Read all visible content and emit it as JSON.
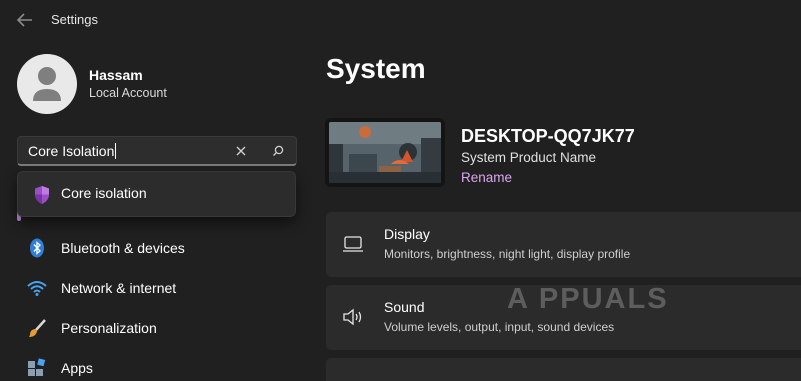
{
  "window": {
    "title": "Settings",
    "back_icon": "back-arrow-icon"
  },
  "user": {
    "name": "Hassam",
    "account_type": "Local Account",
    "avatar_icon": "user-avatar-icon"
  },
  "search": {
    "value": "Core Isolation",
    "clear_icon": "close-icon",
    "search_icon": "search-icon",
    "suggestions": [
      {
        "label": "Core isolation",
        "icon": "shield-icon"
      }
    ]
  },
  "sidebar": {
    "items": [
      {
        "label": "Bluetooth & devices",
        "icon": "bluetooth-icon"
      },
      {
        "label": "Network & internet",
        "icon": "wifi-icon"
      },
      {
        "label": "Personalization",
        "icon": "brush-icon"
      },
      {
        "label": "Apps",
        "icon": "apps-icon"
      }
    ]
  },
  "main": {
    "title": "System",
    "device": {
      "name": "DESKTOP-QQ7JK77",
      "model": "System Product Name",
      "rename_label": "Rename"
    },
    "cards": [
      {
        "title": "Display",
        "subtitle": "Monitors, brightness, night light, display profile",
        "icon": "monitor-icon"
      },
      {
        "title": "Sound",
        "subtitle": "Volume levels, output, input, sound devices",
        "icon": "speaker-icon"
      }
    ]
  },
  "watermark": "A PPUALS",
  "colors": {
    "background": "#202020",
    "card": "#2b2b2b",
    "accent": "#d8a8ee",
    "search_border": "#7c7c7c"
  }
}
